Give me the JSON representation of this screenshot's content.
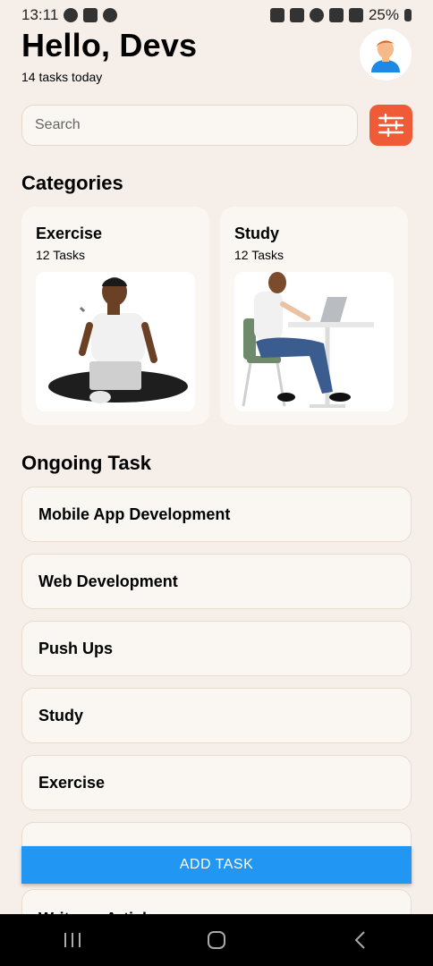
{
  "status_bar": {
    "time": "13:11",
    "battery": "25%"
  },
  "header": {
    "greeting": "Hello, Devs",
    "subtitle": "14 tasks today",
    "avatar_icon": "person-avatar-icon"
  },
  "search": {
    "placeholder": "Search",
    "filter_icon": "sliders-icon"
  },
  "categories": {
    "title": "Categories",
    "items": [
      {
        "name": "Exercise",
        "count": "12 Tasks"
      },
      {
        "name": "Study",
        "count": "12 Tasks"
      }
    ]
  },
  "ongoing": {
    "title": "Ongoing Task",
    "items": [
      {
        "label": "Mobile App Development"
      },
      {
        "label": "Web Development"
      },
      {
        "label": "Push Ups"
      },
      {
        "label": "Study"
      },
      {
        "label": "Exercise"
      },
      {
        "label": ""
      },
      {
        "label": "Write an Article"
      }
    ]
  },
  "add_task": {
    "label": "ADD TASK"
  },
  "colors": {
    "background": "#f6efe9",
    "accent": "#ef5a37",
    "primary_button": "#2196f3"
  }
}
